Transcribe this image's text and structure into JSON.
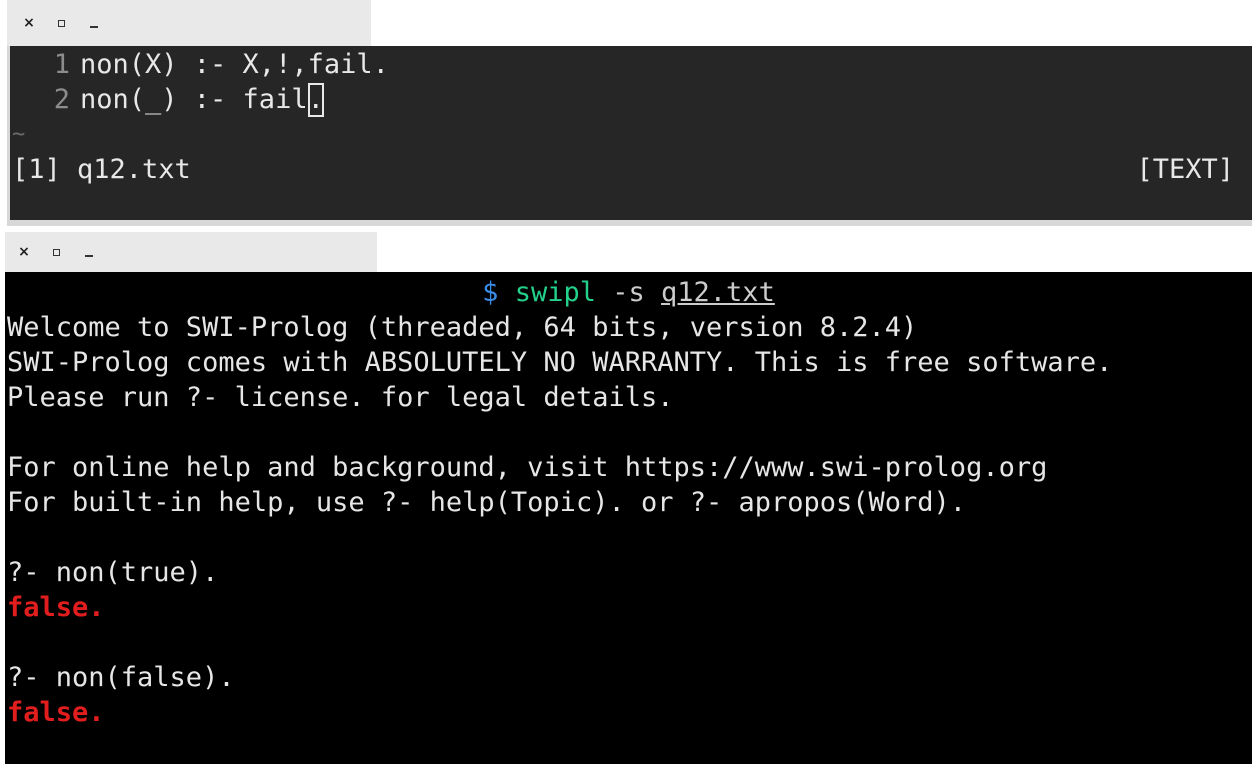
{
  "vim": {
    "lines": [
      {
        "num": "1",
        "text": "non(X) :- X,!,fail."
      },
      {
        "num": "2",
        "text_before_cursor": "non(_) :- fail",
        "cursor_char": "."
      }
    ],
    "tilde": "~",
    "status_left": "[1] q12.txt",
    "status_right": "[TEXT]"
  },
  "terminal": {
    "prompt": {
      "dollar": "$",
      "command": "swipl",
      "flag": "-s",
      "file": "q12.txt"
    },
    "output": [
      "Welcome to SWI-Prolog (threaded, 64 bits, version 8.2.4)",
      "SWI-Prolog comes with ABSOLUTELY NO WARRANTY. This is free software.",
      "Please run ?- license. for legal details.",
      "",
      "For online help and background, visit https://www.swi-prolog.org",
      "For built-in help, use ?- help(Topic). or ?- apropos(Word)."
    ],
    "queries": [
      {
        "query": "?- non(true).",
        "result": "false."
      },
      {
        "query": "?- non(false).",
        "result": "false."
      }
    ]
  },
  "window_controls": {
    "close": "×"
  },
  "colors": {
    "prompt_dollar": "#3b8eea",
    "command": "#23d18b",
    "false_result": "#e21d1d",
    "vim_bg": "#262626",
    "terminal_bg": "#000000"
  }
}
